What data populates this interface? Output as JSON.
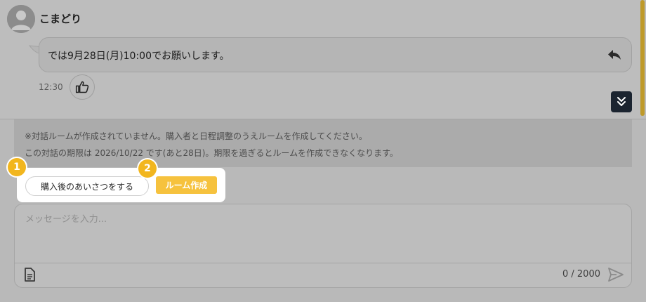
{
  "message": {
    "sender_name": "こまどり",
    "text": "では9月28日(月)10:00でお願いします。",
    "time": "12:30"
  },
  "notice": {
    "line1": "※対話ルームが作成されていません。購入者と日程調整のうえルームを作成してください。",
    "line2": "この対話の期限は 2026/10/22 です(あと28日)。期限を過ぎるとルームを作成できなくなります。"
  },
  "actions": {
    "greet_label": "購入後のあいさつをする",
    "create_room_label": "ルーム作成",
    "step1": "1",
    "step2": "2"
  },
  "composer": {
    "placeholder": "メッセージを入力...",
    "char_current": "0",
    "char_sep": "/",
    "char_max": "2000"
  },
  "icons": {
    "avatar": "user-avatar-icon",
    "reply": "reply-icon",
    "like": "thumbs-up-icon",
    "scroll_down": "double-chevron-down-icon",
    "template": "document-icon",
    "send": "send-icon"
  },
  "colors": {
    "accent": "#f6c23e",
    "badge": "#f2b61e",
    "scroll_button": "#1b2430"
  }
}
